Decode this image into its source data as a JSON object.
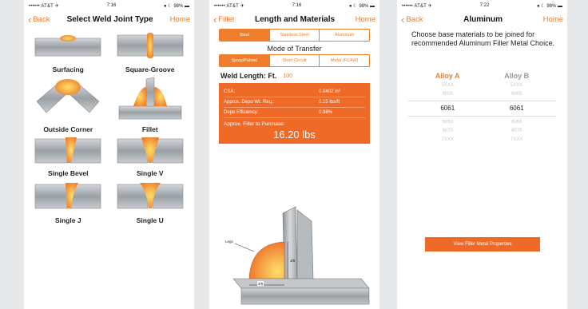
{
  "status": [
    {
      "carrier": "•••••• AT&T ✈",
      "time": "7:16",
      "battery": "● ☾ 98% ▬"
    },
    {
      "carrier": "•••••• AT&T ✈",
      "time": "7:16",
      "battery": "● ☾ 98% ▬"
    },
    {
      "carrier": "•••••• AT&T ✈",
      "time": "7:22",
      "battery": "● ☾ 98% ▬"
    }
  ],
  "screen1": {
    "back": "Back",
    "title": "Select Weld Joint Type",
    "home": "Home",
    "joints": [
      "Surfacing",
      "Square-Groove",
      "Outside Corner",
      "Fillet",
      "Single Bevel",
      "Single V",
      "Single J",
      "Single U"
    ]
  },
  "screen2": {
    "back": "Fillet",
    "title": "Length and Materials",
    "home": "Home",
    "materials": [
      "Steel",
      "Stainless Steel",
      "Aluminum"
    ],
    "mode_title": "Mode of Transfer",
    "modes": [
      "Spray/Pulsed",
      "Short Circuit",
      "Metal (FCAW)"
    ],
    "weld_length_label": "Weld Length: Ft.",
    "weld_length_value": "100",
    "rows": [
      {
        "label": "CSA:",
        "value": "0.0402 in²"
      },
      {
        "label": "Approx. Depo Wt. Req.:",
        "value": "0.15 lbs/ft"
      },
      {
        "label": "Depo Efficiency:",
        "value": "0.98%"
      }
    ],
    "purchase_label": "Approx. Filler to Purchase:",
    "purchase_value": "16.20 lbs",
    "dim_leg": "Legs",
    "dim_a": "3/8",
    "dim_b": "3/8"
  },
  "screen3": {
    "back": "Back",
    "title": "Aluminum",
    "home": "Home",
    "intro": "Choose base materials to be joined for recommended Aluminum Filler Metal Choice.",
    "col_a": "Alloy A",
    "col_b": "Alloy B",
    "rows": [
      {
        "a": "5XXX",
        "b": "5XXX",
        "selected": false
      },
      {
        "a": "6005",
        "b": "6005",
        "selected": false
      },
      {
        "a": "6061",
        "b": "6061",
        "selected": true
      },
      {
        "a": "6063",
        "b": "6063",
        "selected": false
      },
      {
        "a": "6070",
        "b": "6070",
        "selected": false
      },
      {
        "a": "7XXX",
        "b": "7XXX",
        "selected": false
      }
    ],
    "button": "View Filler Metal Properties"
  },
  "colors": {
    "accent": "#ef7d2b",
    "panel": "#ef6a26",
    "steel": "#a9aeb2",
    "weld": "#f39a1e"
  }
}
